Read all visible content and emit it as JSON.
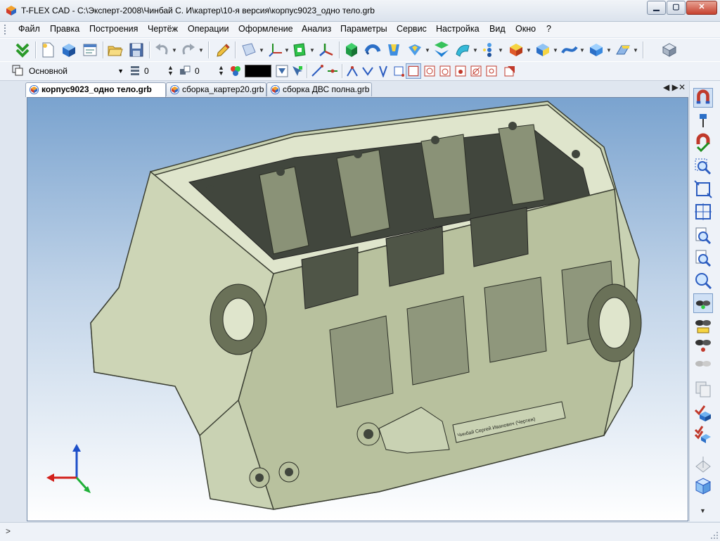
{
  "window": {
    "title": "T-FLEX CAD - C:\\Эксперт-2008\\Чинбай С. И\\картер\\10-я версия\\корпус9023_одно тело.grb"
  },
  "menu": [
    "Файл",
    "Правка",
    "Построения",
    "Чертёж",
    "Операции",
    "Оформление",
    "Анализ",
    "Параметры",
    "Сервис",
    "Настройка",
    "Вид",
    "Окно",
    "?"
  ],
  "toolbar2": {
    "layer": "Основной",
    "level": "0",
    "priority": "0",
    "color": "#000000"
  },
  "tabs": [
    {
      "label": "корпус9023_одно тело.grb",
      "active": true
    },
    {
      "label": "сборка_картер20.grb",
      "active": false
    },
    {
      "label": "сборка ДВС полна.grb",
      "active": false
    }
  ],
  "tab_controls": {
    "arrows": "◀ ▶",
    "close": "✕"
  },
  "model": {
    "engraving": "Чинбай Сергей Иванович (Чертеж)"
  },
  "status": {
    "prompt": ">"
  },
  "colors": {
    "model": "#d6dec1",
    "model_shadow": "#6a7158",
    "bg_top": "#7aa3cf",
    "accent": "#1f5fb8"
  }
}
